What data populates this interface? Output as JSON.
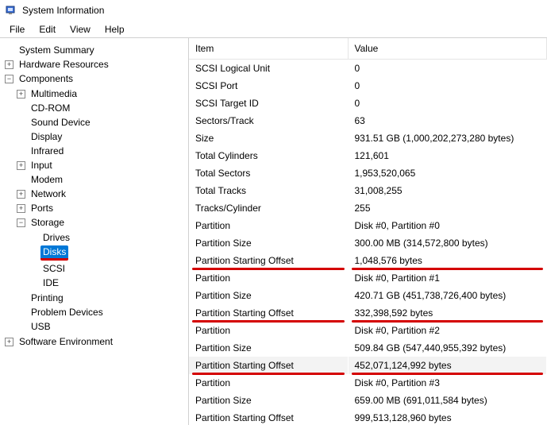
{
  "window": {
    "title": "System Information"
  },
  "menu": {
    "file": "File",
    "edit": "Edit",
    "view": "View",
    "help": "Help"
  },
  "tree": {
    "summary": "System Summary",
    "hardware": "Hardware Resources",
    "components": "Components",
    "multimedia": "Multimedia",
    "cdrom": "CD-ROM",
    "sound": "Sound Device",
    "display": "Display",
    "infrared": "Infrared",
    "input": "Input",
    "modem": "Modem",
    "network": "Network",
    "ports": "Ports",
    "storage": "Storage",
    "drives": "Drives",
    "disks": "Disks",
    "scsi": "SCSI",
    "ide": "IDE",
    "printing": "Printing",
    "problem": "Problem Devices",
    "usb": "USB",
    "software": "Software Environment"
  },
  "list": {
    "header_item": "Item",
    "header_value": "Value",
    "rows": [
      {
        "item": "SCSI Logical Unit",
        "value": "0"
      },
      {
        "item": "SCSI Port",
        "value": "0"
      },
      {
        "item": "SCSI Target ID",
        "value": "0"
      },
      {
        "item": "Sectors/Track",
        "value": "63"
      },
      {
        "item": "Size",
        "value": "931.51 GB (1,000,202,273,280 bytes)"
      },
      {
        "item": "Total Cylinders",
        "value": "121,601"
      },
      {
        "item": "Total Sectors",
        "value": "1,953,520,065"
      },
      {
        "item": "Total Tracks",
        "value": "31,008,255"
      },
      {
        "item": "Tracks/Cylinder",
        "value": "255"
      },
      {
        "item": "Partition",
        "value": "Disk #0, Partition #0"
      },
      {
        "item": "Partition Size",
        "value": "300.00 MB (314,572,800 bytes)"
      },
      {
        "item": "Partition Starting Offset",
        "value": "1,048,576 bytes",
        "uline": true
      },
      {
        "item": "Partition",
        "value": "Disk #0, Partition #1"
      },
      {
        "item": "Partition Size",
        "value": "420.71 GB (451,738,726,400 bytes)"
      },
      {
        "item": "Partition Starting Offset",
        "value": "332,398,592 bytes",
        "uline": true
      },
      {
        "item": "Partition",
        "value": "Disk #0, Partition #2"
      },
      {
        "item": "Partition Size",
        "value": "509.84 GB (547,440,955,392 bytes)"
      },
      {
        "item": "Partition Starting Offset",
        "value": "452,071,124,992 bytes",
        "uline": true,
        "hover": true
      },
      {
        "item": "Partition",
        "value": "Disk #0, Partition #3"
      },
      {
        "item": "Partition Size",
        "value": "659.00 MB (691,011,584 bytes)"
      },
      {
        "item": "Partition Starting Offset",
        "value": "999,513,128,960 bytes",
        "uline": true
      }
    ]
  }
}
